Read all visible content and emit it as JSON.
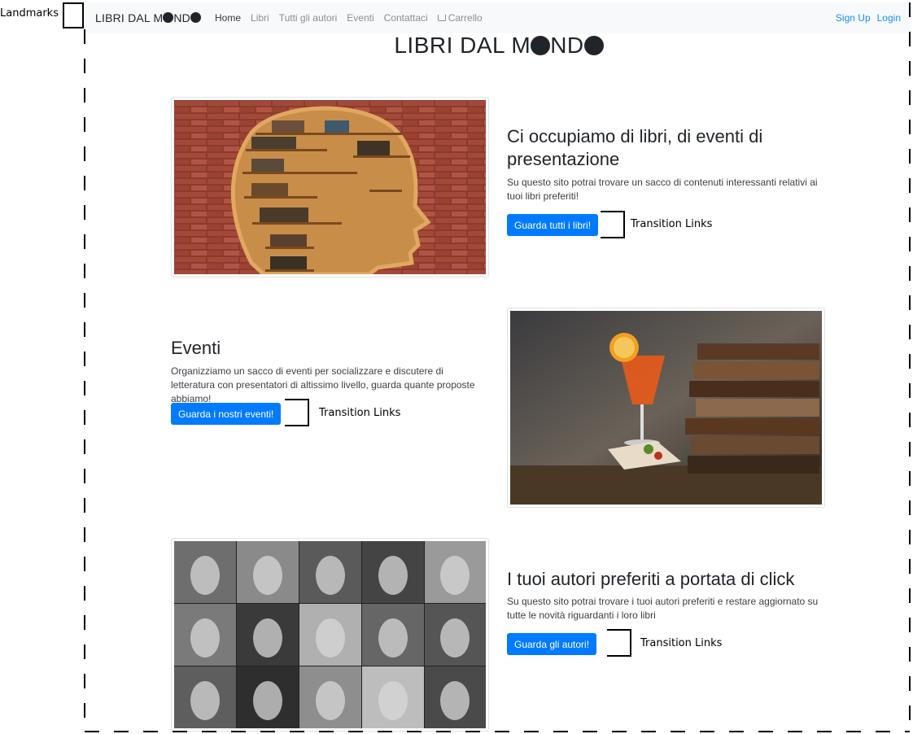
{
  "annotations": {
    "landmarks_label": "Landmarks",
    "transition_links_label": "Transition Links"
  },
  "navbar": {
    "brand": "LIBRI DAL M",
    "brand_end": "ND",
    "items": [
      {
        "label": "Home",
        "active": true
      },
      {
        "label": "Libri",
        "active": false
      },
      {
        "label": "Tutti gli autori",
        "active": false
      },
      {
        "label": "Eventi",
        "active": false
      },
      {
        "label": "Contattaci",
        "active": false
      },
      {
        "label": "Carrello",
        "active": false,
        "icon": "cart-icon"
      }
    ],
    "right": [
      "Sign Up",
      "Login"
    ]
  },
  "header": {
    "title": "LIBRI DAL M",
    "title_end": "ND"
  },
  "sections": [
    {
      "heading": "Ci occupiamo di libri, di eventi di presentazione",
      "text": "Su questo sito potrai trovare un sacco di contenuti interessanti relativi ai tuoi libri preferiti!",
      "button": "Guarda tutti i libri!"
    },
    {
      "heading": "Eventi",
      "text": "Organizziamo un sacco di eventi per socializzare e discutere di letteratura con presentatori di altissimo livello, guarda quante proposte abbiamo!",
      "button": "Guarda i nostri eventi!"
    },
    {
      "heading": "I tuoi autori preferiti a portata di click",
      "text": "Su questo sito potrai trovare i tuoi autori preferiti e restare aggiornato su tutte le novità riguardanti i loro libri",
      "button": "Guarda gli autori!"
    }
  ],
  "colors": {
    "primary": "#007bff",
    "link": "#1a8cff",
    "navbar_bg": "#f8f9fa"
  }
}
